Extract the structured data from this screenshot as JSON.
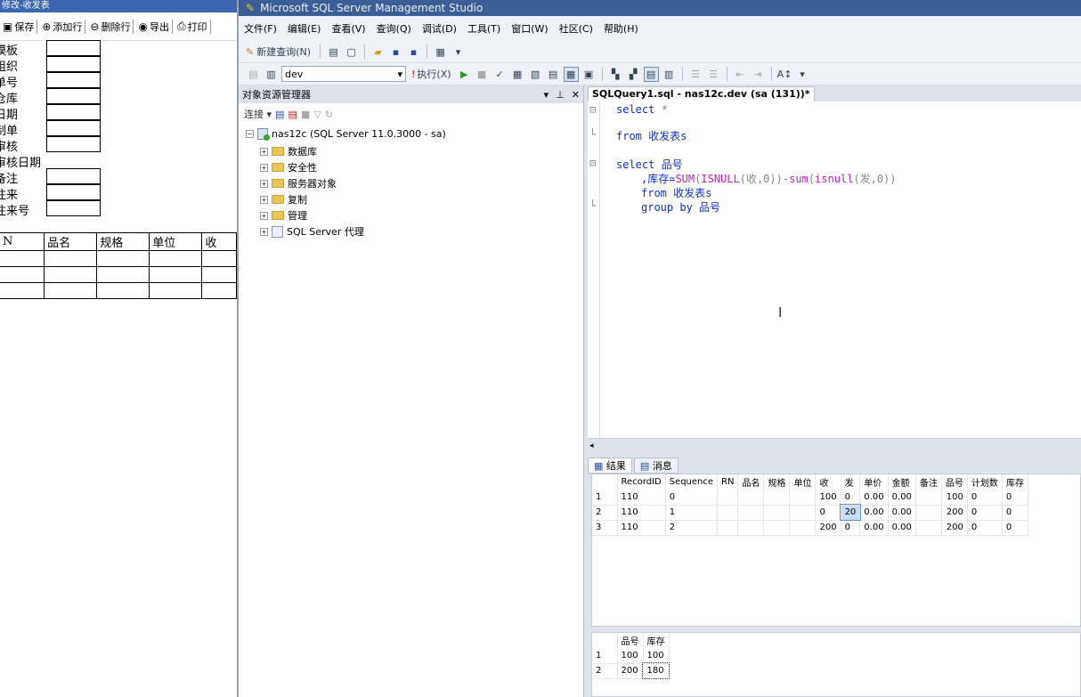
{
  "left_app": {
    "title": "修改-收发表",
    "toolbar": [
      {
        "icon": "save-icon",
        "label": "保存"
      },
      {
        "icon": "add-row-icon",
        "label": "添加行"
      },
      {
        "icon": "delete-row-icon",
        "label": "删除行"
      },
      {
        "icon": "export-icon",
        "label": "导出"
      },
      {
        "icon": "print-icon",
        "label": "打印"
      }
    ],
    "form_labels": [
      "模板",
      "组织",
      "单号",
      "仓库",
      "日期",
      "制单",
      "审核",
      "审核日期",
      "备注",
      "往来",
      "往来号"
    ],
    "form_label_partial": [
      "模板",
      "组织",
      "单号",
      "仓库",
      "日期",
      "制单",
      "审核",
      "审核日期",
      "备注",
      "往来",
      "往来号"
    ],
    "detail_headers": [
      "N",
      "品名",
      "规格",
      "单位",
      "收"
    ]
  },
  "ssms": {
    "window_title": "Microsoft SQL Server Management Studio",
    "menu": [
      "文件(F)",
      "编辑(E)",
      "查看(V)",
      "查询(Q)",
      "调试(D)",
      "工具(T)",
      "窗口(W)",
      "社区(C)",
      "帮助(H)"
    ],
    "toolbar1": {
      "new_query": "新建查询(N)"
    },
    "toolbar2": {
      "database": "dev",
      "execute": "执行(X)"
    },
    "object_explorer": {
      "title": "对象资源管理器",
      "connect": "连接",
      "server": "nas12c (SQL Server 11.0.3000 - sa)",
      "nodes": [
        "数据库",
        "安全性",
        "服务器对象",
        "复制",
        "管理",
        "SQL Server 代理"
      ]
    },
    "query_tab": "SQLQuery1.sql - nas12c.dev (sa (131))*",
    "code": {
      "l1_kw": "select",
      "l1_rest": " *",
      "l2_kw": "from",
      "l2_rest": " 收发表s",
      "l3_kw": "select",
      "l3_rest": " 品号",
      "l4_a": ",库存=",
      "l4_fn1": "SUM",
      "l4_b": "(",
      "l4_fn2": "ISNULL",
      "l4_c": "(收,0))-",
      "l4_fn3": "sum",
      "l4_d": "(",
      "l4_fn4": "isnull",
      "l4_e": "(发,0))",
      "l5_kw": "from",
      "l5_rest": " 收发表s",
      "l6_kw": "group by",
      "l6_rest": " 品号"
    },
    "result_tabs": [
      "结果",
      "消息"
    ],
    "grid1": {
      "headers": [
        "RecordID",
        "Sequence",
        "RN",
        "品名",
        "规格",
        "单位",
        "收",
        "发",
        "单价",
        "金额",
        "备注",
        "品号",
        "计划数",
        "库存"
      ],
      "rows": [
        {
          "n": "1",
          "cells": [
            "110",
            "0",
            "",
            "",
            "",
            "",
            "100",
            "0",
            "0.00",
            "0.00",
            "",
            "100",
            "0",
            "0"
          ]
        },
        {
          "n": "2",
          "cells": [
            "110",
            "1",
            "",
            "",
            "",
            "",
            "0",
            "20",
            "0.00",
            "0.00",
            "",
            "200",
            "0",
            "0"
          ]
        },
        {
          "n": "3",
          "cells": [
            "110",
            "2",
            "",
            "",
            "",
            "",
            "200",
            "0",
            "0.00",
            "0.00",
            "",
            "200",
            "0",
            "0"
          ]
        }
      ]
    },
    "grid2": {
      "headers": [
        "品号",
        "库存"
      ],
      "rows": [
        {
          "n": "1",
          "cells": [
            "100",
            "100"
          ]
        },
        {
          "n": "2",
          "cells": [
            "200",
            "180"
          ]
        }
      ]
    }
  }
}
